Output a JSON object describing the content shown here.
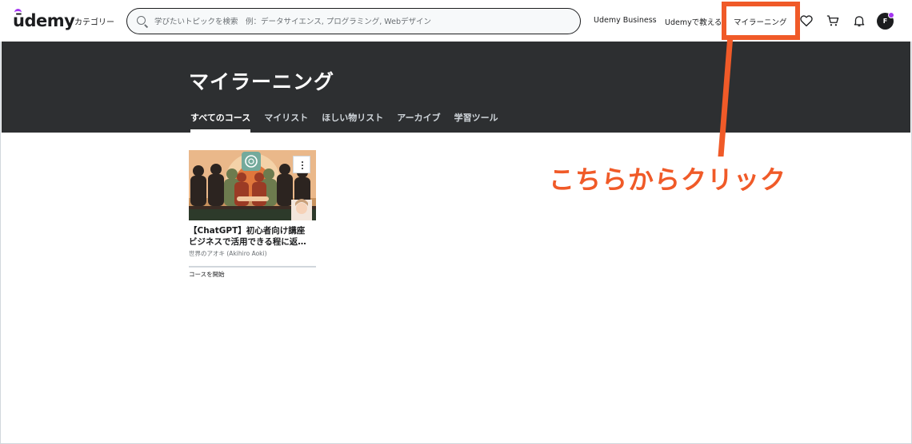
{
  "header": {
    "logo": "ūdemy",
    "categories_label": "カテゴリー",
    "search_placeholder": "学びたいトピックを検索　例：データサイエンス, プログラミング, Webデザイン",
    "nav_business": "Udemy Business",
    "nav_teach": "Udemyで教える",
    "nav_my_learning": "マイラーニング",
    "avatar_initial": "F",
    "icons": [
      "search-icon",
      "heart-icon",
      "cart-icon",
      "bell-icon"
    ]
  },
  "banner": {
    "title": "マイラーニング",
    "tabs": [
      {
        "label": "すべてのコース",
        "active": true
      },
      {
        "label": "マイリスト",
        "active": false
      },
      {
        "label": "ほしい物リスト",
        "active": false
      },
      {
        "label": "アーカイブ",
        "active": false
      },
      {
        "label": "学習ツール",
        "active": false
      }
    ]
  },
  "course": {
    "title_line1": "【ChatGPT】初心者向け講座",
    "title_line2": "ビジネスで活用できる程に返…",
    "instructor": "世界のアオキ (Akihiro Aoki)",
    "start_label": "コースを開始"
  },
  "annotation": {
    "text": "こちらからクリック",
    "color": "#f05a28"
  },
  "colors": {
    "banner_bg": "#2d2f31",
    "brand_purple": "#a435f0"
  }
}
